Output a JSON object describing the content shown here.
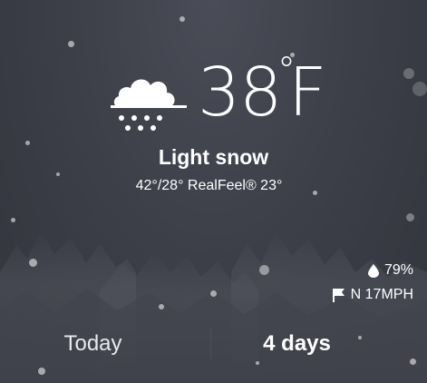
{
  "current": {
    "condition_icon": "snow-cloud-icon",
    "temperature": "38",
    "degree_symbol": "°",
    "unit": "F",
    "condition": "Light snow",
    "range": "42°/28° RealFeel® 23°"
  },
  "details": {
    "humidity_icon": "droplet-icon",
    "humidity": "79%",
    "wind_icon": "flag-icon",
    "wind": "N 17MPH"
  },
  "tabs": [
    {
      "label": "Today",
      "selected": false
    },
    {
      "label": "4 days",
      "selected": true
    }
  ],
  "colors": {
    "background": "#3a3c45",
    "text": "#ffffff"
  }
}
